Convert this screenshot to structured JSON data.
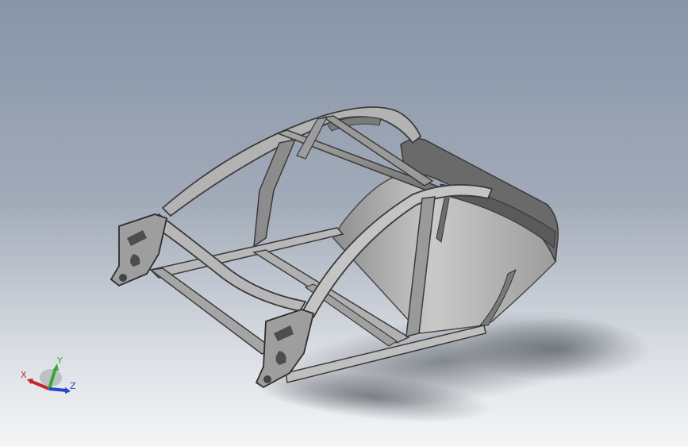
{
  "viewport": {
    "background_top": "#8795a9",
    "background_bottom": "#f4f5f6",
    "model_color": "#8a8a8a"
  },
  "triad": {
    "x_label": "X",
    "y_label": "Y",
    "z_label": "Z",
    "x_color": "#c0272d",
    "y_color": "#3aa63a",
    "z_color": "#2446c4"
  }
}
